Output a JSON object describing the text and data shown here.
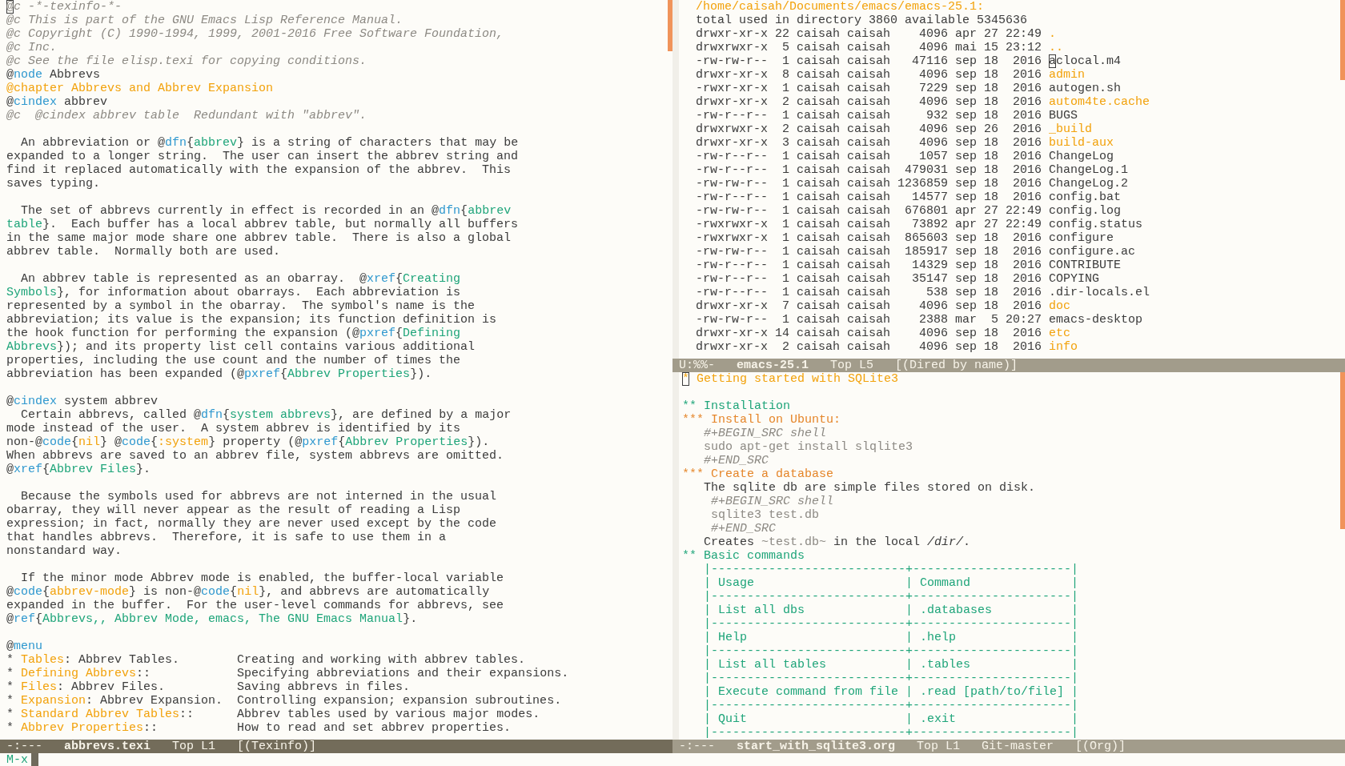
{
  "texinfo_window": {
    "lines": [
      {
        "kind": "text",
        "segments": [
          {
            "kind": "comment",
            "text": "@",
            "cursor": true
          },
          {
            "kind": "comment",
            "text": "c -*-texinfo-*-"
          }
        ]
      },
      {
        "kind": "text",
        "segments": [
          {
            "kind": "comment",
            "text": "@c This is part of the GNU Emacs Lisp Reference Manual."
          }
        ]
      },
      {
        "kind": "text",
        "segments": [
          {
            "kind": "comment",
            "text": "@c Copyright (C) 1990-1994, 1999, 2001-2016 Free Software Foundation,"
          }
        ]
      },
      {
        "kind": "text",
        "segments": [
          {
            "kind": "comment",
            "text": "@c Inc."
          }
        ]
      },
      {
        "kind": "text",
        "segments": [
          {
            "kind": "comment",
            "text": "@c See the file elisp.texi for copying conditions."
          }
        ]
      },
      {
        "kind": "text",
        "segments": [
          {
            "kind": "plain",
            "text": "@"
          },
          {
            "kind": "keyword",
            "text": "node"
          },
          {
            "kind": "plain",
            "text": " Abbrevs"
          }
        ]
      },
      {
        "kind": "text",
        "segments": [
          {
            "kind": "accent",
            "text": "@chapter Abbrevs and Abbrev Expansion"
          }
        ]
      },
      {
        "kind": "text",
        "segments": [
          {
            "kind": "plain",
            "text": "@"
          },
          {
            "kind": "keyword",
            "text": "cindex"
          },
          {
            "kind": "plain",
            "text": " abbrev"
          }
        ]
      },
      {
        "kind": "text",
        "segments": [
          {
            "kind": "comment",
            "text": "@c  @cindex abbrev table  Redundant with \"abbrev\"."
          }
        ]
      },
      {
        "kind": "blank"
      },
      {
        "kind": "text",
        "segments": [
          {
            "kind": "plain",
            "text": "  An abbreviation or @"
          },
          {
            "kind": "keyword",
            "text": "dfn"
          },
          {
            "kind": "plain",
            "text": "{"
          },
          {
            "kind": "argument",
            "text": "abbrev"
          },
          {
            "kind": "plain",
            "text": "} is a string of characters that may be"
          }
        ]
      },
      {
        "kind": "text",
        "segments": [
          {
            "kind": "plain",
            "text": "expanded to a longer string.  The user can insert the abbrev string and"
          }
        ]
      },
      {
        "kind": "text",
        "segments": [
          {
            "kind": "plain",
            "text": "find it replaced automatically with the expansion of the abbrev.  This"
          }
        ]
      },
      {
        "kind": "text",
        "segments": [
          {
            "kind": "plain",
            "text": "saves typing."
          }
        ]
      },
      {
        "kind": "blank"
      },
      {
        "kind": "text",
        "segments": [
          {
            "kind": "plain",
            "text": "  The set of abbrevs currently in effect is recorded in an @"
          },
          {
            "kind": "keyword",
            "text": "dfn"
          },
          {
            "kind": "plain",
            "text": "{"
          },
          {
            "kind": "argument",
            "text": "abbrev"
          }
        ]
      },
      {
        "kind": "text",
        "segments": [
          {
            "kind": "argument",
            "text": "table"
          },
          {
            "kind": "plain",
            "text": "}.  Each buffer has a local abbrev table, but normally all buffers"
          }
        ]
      },
      {
        "kind": "text",
        "segments": [
          {
            "kind": "plain",
            "text": "in the same major mode share one abbrev table.  There is also a global"
          }
        ]
      },
      {
        "kind": "text",
        "segments": [
          {
            "kind": "plain",
            "text": "abbrev table.  Normally both are used."
          }
        ]
      },
      {
        "kind": "blank"
      },
      {
        "kind": "text",
        "segments": [
          {
            "kind": "plain",
            "text": "  An abbrev table is represented as an obarray.  @"
          },
          {
            "kind": "keyword",
            "text": "xref"
          },
          {
            "kind": "plain",
            "text": "{"
          },
          {
            "kind": "argument",
            "text": "Creating"
          }
        ]
      },
      {
        "kind": "text",
        "segments": [
          {
            "kind": "argument",
            "text": "Symbols"
          },
          {
            "kind": "plain",
            "text": "}, for information about obarrays.  Each abbreviation is"
          }
        ]
      },
      {
        "kind": "text",
        "segments": [
          {
            "kind": "plain",
            "text": "represented by a symbol in the obarray.  The symbol's name is the"
          }
        ]
      },
      {
        "kind": "text",
        "segments": [
          {
            "kind": "plain",
            "text": "abbreviation; its value is the expansion; its function definition is"
          }
        ]
      },
      {
        "kind": "text",
        "segments": [
          {
            "kind": "plain",
            "text": "the hook function for performing the expansion (@"
          },
          {
            "kind": "keyword",
            "text": "pxref"
          },
          {
            "kind": "plain",
            "text": "{"
          },
          {
            "kind": "argument",
            "text": "Defining"
          }
        ]
      },
      {
        "kind": "text",
        "segments": [
          {
            "kind": "argument",
            "text": "Abbrevs"
          },
          {
            "kind": "plain",
            "text": "}); and its property list cell contains various additional"
          }
        ]
      },
      {
        "kind": "text",
        "segments": [
          {
            "kind": "plain",
            "text": "properties, including the use count and the number of times the"
          }
        ]
      },
      {
        "kind": "text",
        "segments": [
          {
            "kind": "plain",
            "text": "abbreviation has been expanded (@"
          },
          {
            "kind": "keyword",
            "text": "pxref"
          },
          {
            "kind": "plain",
            "text": "{"
          },
          {
            "kind": "argument",
            "text": "Abbrev Properties"
          },
          {
            "kind": "plain",
            "text": "})."
          }
        ]
      },
      {
        "kind": "blank"
      },
      {
        "kind": "text",
        "segments": [
          {
            "kind": "plain",
            "text": "@"
          },
          {
            "kind": "keyword",
            "text": "cindex"
          },
          {
            "kind": "plain",
            "text": " system abbrev"
          }
        ]
      },
      {
        "kind": "text",
        "segments": [
          {
            "kind": "plain",
            "text": "  Certain abbrevs, called @"
          },
          {
            "kind": "keyword",
            "text": "dfn"
          },
          {
            "kind": "plain",
            "text": "{"
          },
          {
            "kind": "argument",
            "text": "system abbrevs"
          },
          {
            "kind": "plain",
            "text": "}, are defined by a major"
          }
        ]
      },
      {
        "kind": "text",
        "segments": [
          {
            "kind": "plain",
            "text": "mode instead of the user.  A system abbrev is identified by its"
          }
        ]
      },
      {
        "kind": "text",
        "segments": [
          {
            "kind": "plain",
            "text": "non-@"
          },
          {
            "kind": "keyword",
            "text": "code"
          },
          {
            "kind": "plain",
            "text": "{"
          },
          {
            "kind": "accent",
            "text": "nil"
          },
          {
            "kind": "plain",
            "text": "} @"
          },
          {
            "kind": "keyword",
            "text": "code"
          },
          {
            "kind": "plain",
            "text": "{"
          },
          {
            "kind": "accent",
            "text": ":system"
          },
          {
            "kind": "plain",
            "text": "} property (@"
          },
          {
            "kind": "keyword",
            "text": "pxref"
          },
          {
            "kind": "plain",
            "text": "{"
          },
          {
            "kind": "argument",
            "text": "Abbrev Properties"
          },
          {
            "kind": "plain",
            "text": "})."
          }
        ]
      },
      {
        "kind": "text",
        "segments": [
          {
            "kind": "plain",
            "text": "When abbrevs are saved to an abbrev file, system abbrevs are omitted."
          }
        ]
      },
      {
        "kind": "text",
        "segments": [
          {
            "kind": "plain",
            "text": "@"
          },
          {
            "kind": "keyword",
            "text": "xref"
          },
          {
            "kind": "plain",
            "text": "{"
          },
          {
            "kind": "argument",
            "text": "Abbrev Files"
          },
          {
            "kind": "plain",
            "text": "}."
          }
        ]
      },
      {
        "kind": "blank"
      },
      {
        "kind": "text",
        "segments": [
          {
            "kind": "plain",
            "text": "  Because the symbols used for abbrevs are not interned in the usual"
          }
        ]
      },
      {
        "kind": "text",
        "segments": [
          {
            "kind": "plain",
            "text": "obarray, they will never appear as the result of reading a Lisp"
          }
        ]
      },
      {
        "kind": "text",
        "segments": [
          {
            "kind": "plain",
            "text": "expression; in fact, normally they are never used except by the code"
          }
        ]
      },
      {
        "kind": "text",
        "segments": [
          {
            "kind": "plain",
            "text": "that handles abbrevs.  Therefore, it is safe to use them in a"
          }
        ]
      },
      {
        "kind": "text",
        "segments": [
          {
            "kind": "plain",
            "text": "nonstandard way."
          }
        ]
      },
      {
        "kind": "blank"
      },
      {
        "kind": "text",
        "segments": [
          {
            "kind": "plain",
            "text": "  If the minor mode Abbrev mode is enabled, the buffer-local variable"
          }
        ]
      },
      {
        "kind": "text",
        "segments": [
          {
            "kind": "plain",
            "text": "@"
          },
          {
            "kind": "keyword",
            "text": "code"
          },
          {
            "kind": "plain",
            "text": "{"
          },
          {
            "kind": "accent",
            "text": "abbrev-mode"
          },
          {
            "kind": "plain",
            "text": "} is non-@"
          },
          {
            "kind": "keyword",
            "text": "code"
          },
          {
            "kind": "plain",
            "text": "{"
          },
          {
            "kind": "accent",
            "text": "nil"
          },
          {
            "kind": "plain",
            "text": "}, and abbrevs are automatically"
          }
        ]
      },
      {
        "kind": "text",
        "segments": [
          {
            "kind": "plain",
            "text": "expanded in the buffer.  For the user-level commands for abbrevs, see"
          }
        ]
      },
      {
        "kind": "text",
        "segments": [
          {
            "kind": "plain",
            "text": "@"
          },
          {
            "kind": "keyword",
            "text": "ref"
          },
          {
            "kind": "plain",
            "text": "{"
          },
          {
            "kind": "argument",
            "text": "Abbrevs,, Abbrev Mode, emacs, The GNU Emacs Manual"
          },
          {
            "kind": "plain",
            "text": "}."
          }
        ]
      },
      {
        "kind": "blank"
      },
      {
        "kind": "text",
        "segments": [
          {
            "kind": "plain",
            "text": "@"
          },
          {
            "kind": "keyword",
            "text": "menu"
          }
        ]
      },
      {
        "kind": "text",
        "segments": [
          {
            "kind": "plain",
            "text": "* "
          },
          {
            "kind": "accent",
            "text": "Tables"
          },
          {
            "kind": "plain",
            "text": ": Abbrev Tables.        Creating and working with abbrev tables."
          }
        ]
      },
      {
        "kind": "text",
        "segments": [
          {
            "kind": "plain",
            "text": "* "
          },
          {
            "kind": "accent",
            "text": "Defining Abbrevs"
          },
          {
            "kind": "plain",
            "text": "::            Specifying abbreviations and their expansions."
          }
        ]
      },
      {
        "kind": "text",
        "segments": [
          {
            "kind": "plain",
            "text": "* "
          },
          {
            "kind": "accent",
            "text": "Files"
          },
          {
            "kind": "plain",
            "text": ": Abbrev Files.          Saving abbrevs in files."
          }
        ]
      },
      {
        "kind": "text",
        "segments": [
          {
            "kind": "plain",
            "text": "* "
          },
          {
            "kind": "accent",
            "text": "Expansion"
          },
          {
            "kind": "plain",
            "text": ": Abbrev Expansion.  Controlling expansion; expansion subroutines."
          }
        ]
      },
      {
        "kind": "text",
        "segments": [
          {
            "kind": "plain",
            "text": "* "
          },
          {
            "kind": "accent",
            "text": "Standard Abbrev Tables"
          },
          {
            "kind": "plain",
            "text": "::      Abbrev tables used by various major modes."
          }
        ]
      },
      {
        "kind": "text",
        "segments": [
          {
            "kind": "plain",
            "text": "* "
          },
          {
            "kind": "accent",
            "text": "Abbrev Properties"
          },
          {
            "kind": "plain",
            "text": "::           How to read and set abbrev properties."
          }
        ]
      }
    ],
    "mode_line": {
      "selected": true,
      "state": "-:---",
      "buffer": "abbrevs.texi",
      "position": "Top L1",
      "mode": "[(Texinfo)]"
    }
  },
  "dired_window": {
    "header": "/home/caisah/Documents/emacs/emacs-25.1:",
    "summary": "total used in directory 3860 available 5345636",
    "entries": [
      {
        "details": "drwxr-xr-x 22 caisah caisah    4096 apr 27 22:49",
        "name": ".",
        "kind": "dir",
        "cursor": false
      },
      {
        "details": "drwxrwxr-x  5 caisah caisah    4096 mai 15 23:12",
        "name": "..",
        "kind": "dir",
        "cursor": false
      },
      {
        "details": "-rw-rw-r--  1 caisah caisah   47116 sep 18  2016",
        "name": "aclocal.m4",
        "kind": "file",
        "cursor": true
      },
      {
        "details": "drwxr-xr-x  8 caisah caisah    4096 sep 18  2016",
        "name": "admin",
        "kind": "dir",
        "cursor": false
      },
      {
        "details": "-rwxr-xr-x  1 caisah caisah    7229 sep 18  2016",
        "name": "autogen.sh",
        "kind": "file",
        "cursor": false
      },
      {
        "details": "drwxr-xr-x  2 caisah caisah    4096 sep 18  2016",
        "name": "autom4te.cache",
        "kind": "dir",
        "cursor": false
      },
      {
        "details": "-rw-r--r--  1 caisah caisah     932 sep 18  2016",
        "name": "BUGS",
        "kind": "file",
        "cursor": false
      },
      {
        "details": "drwxrwxr-x  2 caisah caisah    4096 sep 26  2016",
        "name": "_build",
        "kind": "dir",
        "cursor": false
      },
      {
        "details": "drwxr-xr-x  3 caisah caisah    4096 sep 18  2016",
        "name": "build-aux",
        "kind": "dir",
        "cursor": false
      },
      {
        "details": "-rw-r--r--  1 caisah caisah    1057 sep 18  2016",
        "name": "ChangeLog",
        "kind": "file",
        "cursor": false
      },
      {
        "details": "-rw-r--r--  1 caisah caisah  479031 sep 18  2016",
        "name": "ChangeLog.1",
        "kind": "file",
        "cursor": false
      },
      {
        "details": "-rw-rw-r--  1 caisah caisah 1236859 sep 18  2016",
        "name": "ChangeLog.2",
        "kind": "file",
        "cursor": false
      },
      {
        "details": "-rw-r--r--  1 caisah caisah   14577 sep 18  2016",
        "name": "config.bat",
        "kind": "file",
        "cursor": false
      },
      {
        "details": "-rw-rw-r--  1 caisah caisah  676801 apr 27 22:49",
        "name": "config.log",
        "kind": "file",
        "cursor": false
      },
      {
        "details": "-rwxrwxr-x  1 caisah caisah   73892 apr 27 22:49",
        "name": "config.status",
        "kind": "file",
        "cursor": false
      },
      {
        "details": "-rwxrwxr-x  1 caisah caisah  865603 sep 18  2016",
        "name": "configure",
        "kind": "file",
        "cursor": false
      },
      {
        "details": "-rw-rw-r--  1 caisah caisah  185917 sep 18  2016",
        "name": "configure.ac",
        "kind": "file",
        "cursor": false
      },
      {
        "details": "-rw-r--r--  1 caisah caisah   14329 sep 18  2016",
        "name": "CONTRIBUTE",
        "kind": "file",
        "cursor": false
      },
      {
        "details": "-rw-r--r--  1 caisah caisah   35147 sep 18  2016",
        "name": "COPYING",
        "kind": "file",
        "cursor": false
      },
      {
        "details": "-rw-r--r--  1 caisah caisah     538 sep 18  2016",
        "name": ".dir-locals.el",
        "kind": "file",
        "cursor": false
      },
      {
        "details": "drwxr-xr-x  7 caisah caisah    4096 sep 18  2016",
        "name": "doc",
        "kind": "dir",
        "cursor": false
      },
      {
        "details": "-rw-rw-r--  1 caisah caisah    2388 mar  5 20:27",
        "name": "emacs-desktop",
        "kind": "file",
        "cursor": false
      },
      {
        "details": "drwxr-xr-x 14 caisah caisah    4096 sep 18  2016",
        "name": "etc",
        "kind": "dir",
        "cursor": false
      },
      {
        "details": "drwxr-xr-x  2 caisah caisah    4096 sep 18  2016",
        "name": "info",
        "kind": "dir",
        "cursor": false
      }
    ],
    "mode_line": {
      "selected": false,
      "state": "U:%%-",
      "buffer": "emacs-25.1",
      "position": "Top L5",
      "mode": "[(Dired by name)]"
    }
  },
  "org_window": {
    "lines": [
      {
        "kind": "text",
        "segments": [
          {
            "kind": "level1",
            "text": "*",
            "cursor": true
          },
          {
            "kind": "level1",
            "text": " Getting started with SQLite3"
          }
        ]
      },
      {
        "kind": "blank"
      },
      {
        "kind": "text",
        "segments": [
          {
            "kind": "level2",
            "text": "** Installation"
          }
        ]
      },
      {
        "kind": "text",
        "segments": [
          {
            "kind": "level3",
            "text": "*** Install on Ubuntu:"
          }
        ]
      },
      {
        "kind": "text",
        "segments": [
          {
            "kind": "meta",
            "text": "   #+BEGIN_SRC shell"
          }
        ]
      },
      {
        "kind": "text",
        "segments": [
          {
            "kind": "verbatim",
            "text": "   sudo apt-get install slqlite3"
          }
        ]
      },
      {
        "kind": "text",
        "segments": [
          {
            "kind": "meta",
            "text": "   #+END_SRC"
          }
        ]
      },
      {
        "kind": "text",
        "segments": [
          {
            "kind": "level3",
            "text": "*** Create a database"
          }
        ]
      },
      {
        "kind": "text",
        "segments": [
          {
            "kind": "plain",
            "text": "   The sqlite db are simple files stored on disk."
          }
        ]
      },
      {
        "kind": "text",
        "segments": [
          {
            "kind": "meta",
            "text": "    #+BEGIN_SRC shell"
          }
        ]
      },
      {
        "kind": "text",
        "segments": [
          {
            "kind": "verbatim",
            "text": "    sqlite3 test.db"
          }
        ]
      },
      {
        "kind": "text",
        "segments": [
          {
            "kind": "meta",
            "text": "    #+END_SRC"
          }
        ]
      },
      {
        "kind": "text",
        "segments": [
          {
            "kind": "plain",
            "text": "   Creates "
          },
          {
            "kind": "verbatim",
            "text": "~test.db~"
          },
          {
            "kind": "plain",
            "text": " in the local "
          },
          {
            "kind": "emphasis",
            "text": "/dir/"
          },
          {
            "kind": "plain",
            "text": "."
          }
        ]
      },
      {
        "kind": "text",
        "segments": [
          {
            "kind": "level2",
            "text": "** Basic commands"
          }
        ]
      },
      {
        "kind": "table",
        "segments": [
          {
            "kind": "table",
            "text": "   |---------------------------+----------------------|"
          }
        ]
      },
      {
        "kind": "table",
        "segments": [
          {
            "kind": "table",
            "text": "   | Usage                     | Command              |"
          }
        ]
      },
      {
        "kind": "table",
        "segments": [
          {
            "kind": "table",
            "text": "   |---------------------------+----------------------|"
          }
        ]
      },
      {
        "kind": "table",
        "segments": [
          {
            "kind": "table",
            "text": "   | List all dbs              | .databases           |"
          }
        ]
      },
      {
        "kind": "table",
        "segments": [
          {
            "kind": "table",
            "text": "   |---------------------------+----------------------|"
          }
        ]
      },
      {
        "kind": "table",
        "segments": [
          {
            "kind": "table",
            "text": "   | Help                      | .help                |"
          }
        ]
      },
      {
        "kind": "table",
        "segments": [
          {
            "kind": "table",
            "text": "   |---------------------------+----------------------|"
          }
        ]
      },
      {
        "kind": "table",
        "segments": [
          {
            "kind": "table",
            "text": "   | List all tables           | .tables              |"
          }
        ]
      },
      {
        "kind": "table",
        "segments": [
          {
            "kind": "table",
            "text": "   |---------------------------+----------------------|"
          }
        ]
      },
      {
        "kind": "table",
        "segments": [
          {
            "kind": "table",
            "text": "   | Execute command from file | .read [path/to/file] |"
          }
        ]
      },
      {
        "kind": "table",
        "segments": [
          {
            "kind": "table",
            "text": "   |---------------------------+----------------------|"
          }
        ]
      },
      {
        "kind": "table",
        "segments": [
          {
            "kind": "table",
            "text": "   | Quit                      | .exit                |"
          }
        ]
      },
      {
        "kind": "table",
        "segments": [
          {
            "kind": "table",
            "text": "   |---------------------------+----------------------|"
          }
        ]
      }
    ],
    "mode_line": {
      "selected": false,
      "state": "-:---",
      "buffer": "start_with_sqlite3.org",
      "position": "Top L1",
      "vc": "Git-master",
      "mode": "[(Org)]"
    }
  },
  "minibuffer": {
    "prompt": "M-x",
    "cursor": true
  }
}
